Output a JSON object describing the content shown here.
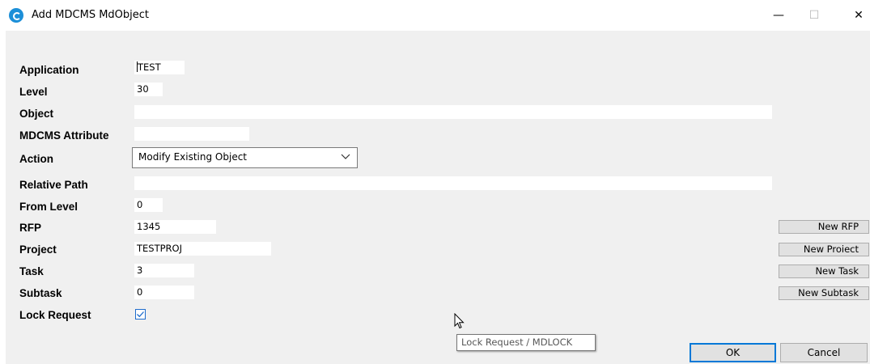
{
  "window": {
    "title": "Add MDCMS MdObject",
    "controls": {
      "minimize": "—",
      "maximize": "☐",
      "close": "✕"
    }
  },
  "form": {
    "application": {
      "label": "Application",
      "value": "TEST"
    },
    "level": {
      "label": "Level",
      "value": "30"
    },
    "object": {
      "label": "Object",
      "value": ""
    },
    "mdcms_attribute": {
      "label": "MDCMS Attribute",
      "value": ""
    },
    "action": {
      "label": "Action",
      "value": "Modify Existing Object"
    },
    "relative_path": {
      "label": "Relative Path",
      "value": ""
    },
    "from_level": {
      "label": "From Level",
      "value": "0"
    },
    "rfp": {
      "label": "RFP",
      "value": "1345"
    },
    "project": {
      "label": "Project",
      "value": "TESTPROJ"
    },
    "task": {
      "label": "Task",
      "value": "3"
    },
    "subtask": {
      "label": "Subtask",
      "value": "0"
    },
    "lock_request": {
      "label": "Lock Request",
      "checked": true
    }
  },
  "side_buttons": {
    "new_rfp": "New RFP",
    "new_project": "New Proiect",
    "new_task": "New Task",
    "new_subtask": "New Subtask"
  },
  "tooltip": "Lock Request / MDLOCK",
  "buttons": {
    "ok": "OK",
    "cancel": "Cancel"
  },
  "colors": {
    "accent": "#0078d7",
    "app_icon": "#1c8fd8",
    "checkbox": "#1e6ccc"
  },
  "icons": {
    "app": "mdcms-app-icon",
    "dropdown": "chevron-down-icon",
    "check": "checkmark-icon",
    "cursor": "mouse-pointer-icon"
  }
}
